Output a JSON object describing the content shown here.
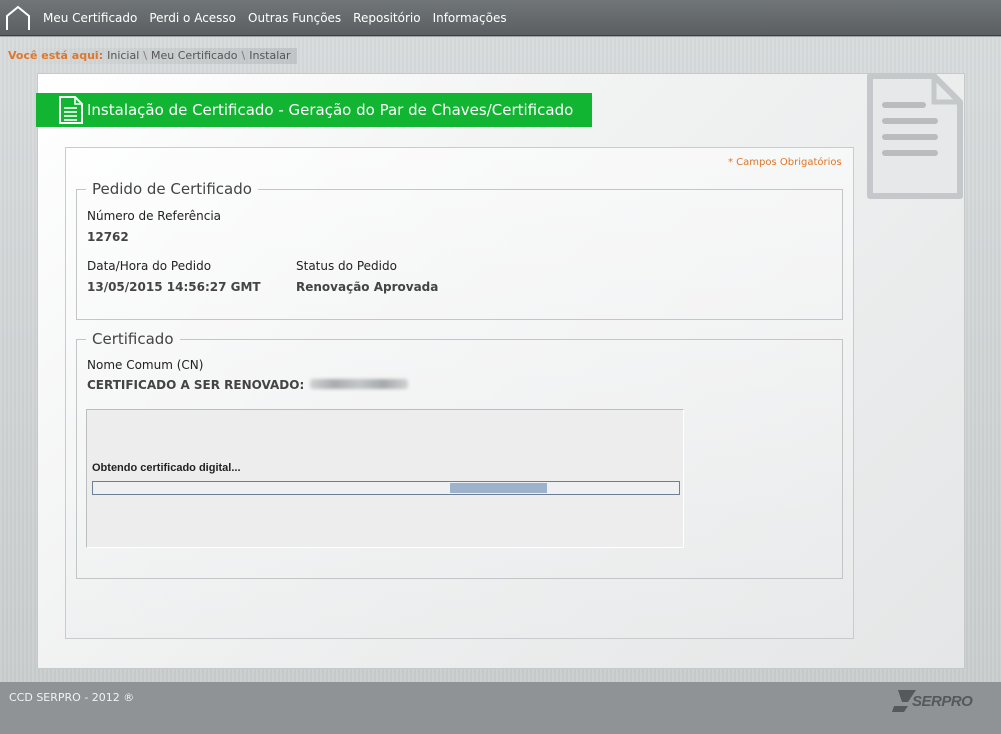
{
  "nav": {
    "items": [
      {
        "label": "Meu Certificado"
      },
      {
        "label": "Perdi o Acesso"
      },
      {
        "label": "Outras Funções"
      },
      {
        "label": "Repositório"
      },
      {
        "label": "Informações"
      }
    ]
  },
  "breadcrumb": {
    "label": "Você está aqui:",
    "items": [
      "Inicial",
      "Meu Certificado",
      "Instalar"
    ],
    "separator": "\\"
  },
  "page": {
    "title": "Instalação de Certificado - Geração do Par de Chaves/Certificado",
    "required_note": "* Campos Obrigatórios"
  },
  "pedido": {
    "legend": "Pedido de Certificado",
    "ref_label": "Número de Referência",
    "ref_value": "12762",
    "date_label": "Data/Hora do Pedido",
    "date_value": "13/05/2015 14:56:27 GMT",
    "status_label": "Status do Pedido",
    "status_value": "Renovação Aprovada"
  },
  "certificado": {
    "legend": "Certificado",
    "cn_label": "Nome Comum (CN)",
    "cn_value": "CERTIFICADO A SER RENOVADO:"
  },
  "applet": {
    "status_text": "Obtendo certificado digital...",
    "progress_start": 0.61,
    "progress_end": 0.775
  },
  "footer": {
    "copyright": "CCD SERPRO - 2012 ®",
    "logo_text": "SERPRO"
  },
  "colors": {
    "accent_green": "#12b532",
    "accent_orange": "#e0762a",
    "progress_fill": "#9db3cc"
  }
}
